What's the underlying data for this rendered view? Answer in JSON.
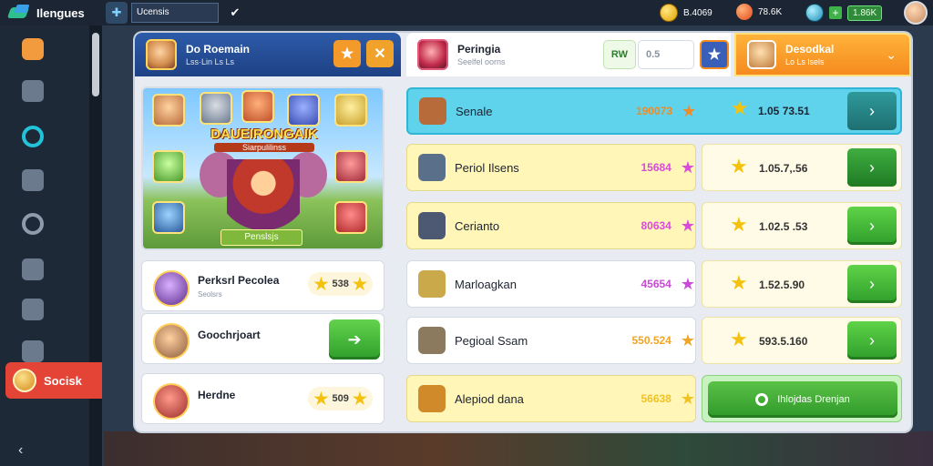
{
  "topbar": {
    "app_title": "Ilengues",
    "search_value": "Ucensis",
    "resources": [
      {
        "icon": "coin-icon",
        "value": "B.4069"
      },
      {
        "icon": "gem-icon",
        "value": "78.6K"
      },
      {
        "icon": "orb-icon",
        "value": "1.86K"
      }
    ]
  },
  "sidebar": {
    "items": [
      "camera-icon",
      "keyhole-icon",
      "wifi-icon",
      "shop-icon",
      "ring-icon",
      "puzzle-icon",
      "chat-icon",
      "gear-icon"
    ],
    "social_label": "Socisk"
  },
  "left_panel": {
    "header_title": "Do Roemain",
    "header_sub": "Lss·Lin Ls Ls",
    "banner_title": "DAUEIRONGAIK",
    "banner_sub": "Siarpulilinss",
    "banner_button": "Penslsjs",
    "cards": [
      {
        "name": "Perksrl Pecolea",
        "sub": "Seolsrs",
        "pill": "538"
      },
      {
        "name": "Goochrjoart",
        "sub": ""
      },
      {
        "name": "Herdne",
        "sub": "",
        "pill": "509"
      }
    ]
  },
  "right_panel": {
    "header_title": "Peringia",
    "header_sub": "Seelfel oorns",
    "mini_a": "RW",
    "mini_b": "0.5",
    "selected_tab_title": "Desodkal",
    "selected_tab_sub": "Lo Ls lsels",
    "rows": [
      {
        "name": "Senale",
        "value": "190073",
        "mark": "★",
        "mark_color": "#f08a24",
        "row_bg": "#5fd3ec",
        "icon_color": "#b86b3a",
        "reward": "1.05 73.51"
      },
      {
        "name": "Periol Ilsens",
        "value": "15684",
        "mark": "★",
        "mark_color": "#d94bd9",
        "row_bg": "#fff6b8",
        "icon_color": "#5a6f8a",
        "reward": "1.05.7,.56"
      },
      {
        "name": "Cerianto",
        "value": "80634",
        "mark": "★",
        "mark_color": "#d94bd9",
        "row_bg": "#fff6b8",
        "icon_color": "#4d5873",
        "reward": "1.02.5 .53"
      },
      {
        "name": "Marloagkan",
        "value": "45654",
        "mark": "★",
        "mark_color": "#c94ad6",
        "row_bg": "#ffffff",
        "icon_color": "#caa94a",
        "reward": "1.52.5.90"
      },
      {
        "name": "Pegioal Ssam",
        "value": "550.524",
        "mark": "★",
        "mark_color": "#f0a524",
        "row_bg": "#ffffff",
        "icon_color": "#8c7a5e",
        "reward": "593.5.160"
      },
      {
        "name": "Alepiod dana",
        "value": "56638",
        "mark": "★",
        "mark_color": "#f0c224",
        "row_bg": "#fff6b8",
        "icon_color": "#d08a2a"
      }
    ],
    "big_button": "Ihlojdas Drenjan"
  }
}
